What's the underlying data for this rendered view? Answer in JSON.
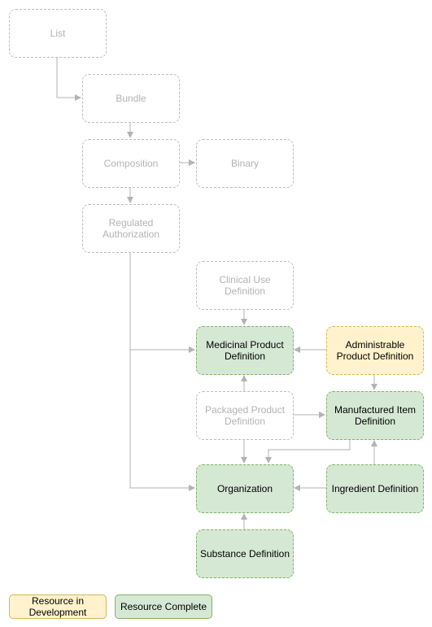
{
  "colors": {
    "complete_fill": "#d5e8d4",
    "complete_border": "#82b366",
    "dev_fill": "#fff2cc",
    "dev_border": "#d6b656",
    "ghost_border": "#bdbdbd",
    "edge": "#b3b3b3"
  },
  "nodes": {
    "list": "List",
    "bundle": "Bundle",
    "composition": "Composition",
    "binary": "Binary",
    "regulated_authorization": "Regulated Authorization",
    "clinical_use": "Clinical Use Definition",
    "medicinal_product": "Medicinal Product Definition",
    "administrable_product": "Administrable Product Definition",
    "packaged_product": "Packaged Product Definition",
    "manufactured_item": "Manufactured Item Definition",
    "organization": "Organization",
    "ingredient": "Ingredient Definition",
    "substance": "Substance Definition"
  },
  "legend": {
    "in_development": "Resource in Development",
    "complete": "Resource Complete"
  }
}
